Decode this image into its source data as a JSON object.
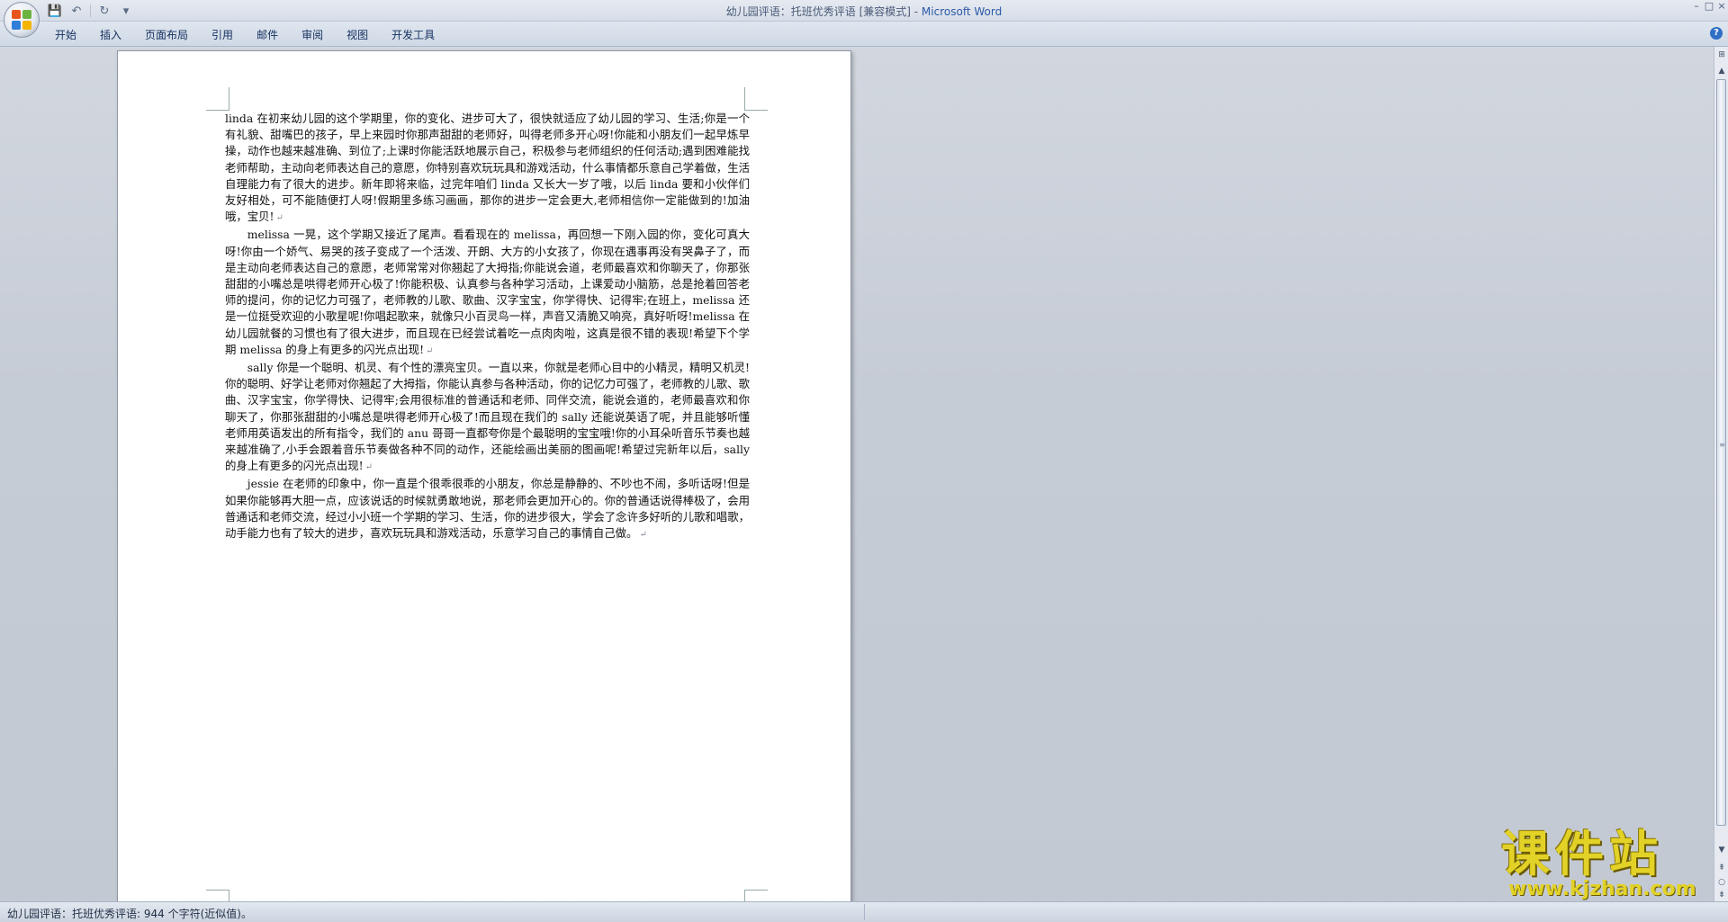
{
  "window": {
    "title": "幼儿园评语：托班优秀评语 [兼容模式] - ",
    "app_name": "Microsoft Word",
    "controls": {
      "minimize": "–",
      "maximize": "□",
      "close": "×"
    }
  },
  "quick_access": {
    "save_icon": "💾",
    "undo_icon": "↶",
    "redo_icon": "↻",
    "customize_icon": "▾"
  },
  "ribbon": {
    "tabs": [
      "开始",
      "插入",
      "页面布局",
      "引用",
      "邮件",
      "审阅",
      "视图",
      "开发工具"
    ],
    "help": "?"
  },
  "document": {
    "paragraphs": [
      {
        "text": "linda 在初来幼儿园的这个学期里，你的变化、进步可大了，很快就适应了幼儿园的学习、生活;你是一个有礼貌、甜嘴巴的孩子，早上来园时你那声甜甜的老师好，叫得老师多开心呀!你能和小朋友们一起早炼早操，动作也越来越准确、到位了;上课时你能活跃地展示自己，积极参与老师组织的任何活动;遇到困难能找老师帮助，主动向老师表达自己的意愿，你特别喜欢玩玩具和游戏活动，什么事情都乐意自己学着做，生活自理能力有了很大的进步。新年即将来临，过完年咱们 linda 又长大一岁了哦，以后 linda 要和小伙伴们友好相处，可不能随便打人呀!假期里多练习画画，那你的进步一定会更大,老师相信你一定能做到的!加油哦，宝贝!",
        "indent": false
      },
      {
        "text": "melissa 一晃，这个学期又接近了尾声。看看现在的 melissa，再回想一下刚入园的你，变化可真大呀!你由一个娇气、易哭的孩子变成了一个活泼、开朗、大方的小女孩了，你现在遇事再没有哭鼻子了，而是主动向老师表达自己的意愿，老师常常对你翘起了大拇指;你能说会道，老师最喜欢和你聊天了，你那张甜甜的小嘴总是哄得老师开心极了!你能积极、认真参与各种学习活动，上课爱动小脑筋，总是抢着回答老师的提问，你的记忆力可强了，老师教的儿歌、歌曲、汉字宝宝，你学得快、记得牢;在班上，melissa 还是一位挺受欢迎的小歌星呢!你唱起歌来，就像只小百灵鸟一样，声音又清脆又响亮，真好听呀!melissa 在幼儿园就餐的习惯也有了很大进步，而且现在已经尝试着吃一点肉肉啦，这真是很不错的表现!希望下个学期 melissa 的身上有更多的闪光点出现!",
        "indent": true
      },
      {
        "text": "sally 你是一个聪明、机灵、有个性的漂亮宝贝。一直以来，你就是老师心目中的小精灵，精明又机灵!你的聪明、好学让老师对你翘起了大拇指，你能认真参与各种活动，你的记忆力可强了，老师教的儿歌、歌曲、汉字宝宝，你学得快、记得牢;会用很标准的普通话和老师、同伴交流，能说会道的，老师最喜欢和你聊天了，你那张甜甜的小嘴总是哄得老师开心极了!而且现在我们的 sally 还能说英语了呢，并且能够听懂老师用英语发出的所有指令，我们的 anu 哥哥一直都夸你是个最聪明的宝宝哦!你的小耳朵听音乐节奏也越来越准确了,小手会跟着音乐节奏做各种不同的动作，还能绘画出美丽的图画呢!希望过完新年以后，sally 的身上有更多的闪光点出现!",
        "indent": true
      },
      {
        "text": "jessie 在老师的印象中，你一直是个很乖很乖的小朋友，你总是静静的、不吵也不闹，多听话呀!但是如果你能够再大胆一点，应该说话的时候就勇敢地说，那老师会更加开心的。你的普通话说得棒极了，会用普通话和老师交流，经过小小班一个学期的学习、生活，你的进步很大，学会了念许多好听的儿歌和唱歌，动手能力也有了较大的进步，喜欢玩玩具和游戏活动，乐意学习自己的事情自己做。",
        "indent": true
      }
    ],
    "paragraph_mark": "↵"
  },
  "scrollbar": {
    "ruler_icon": "⊞",
    "up_icon": "▲",
    "down_icon": "▼",
    "prev_page_icon": "⇞",
    "browse_object_icon": "○",
    "next_page_icon": "⇟",
    "thumb_fraction": 1.0
  },
  "status_bar": {
    "text": "幼儿园评语：托班优秀评语: 944 个字符(近似值)。"
  },
  "watermark": {
    "brand": "课件站",
    "url": "www.kjzhan.com"
  }
}
